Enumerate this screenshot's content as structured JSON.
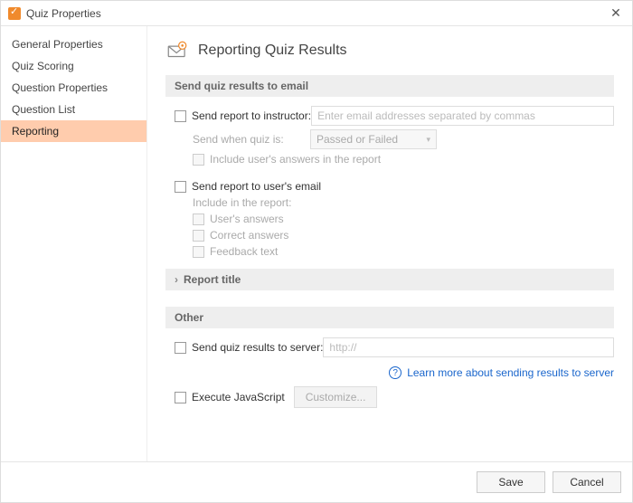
{
  "window": {
    "title": "Quiz Properties",
    "close_label": "✕"
  },
  "sidebar": {
    "items": [
      {
        "label": "General Properties"
      },
      {
        "label": "Quiz Scoring"
      },
      {
        "label": "Question Properties"
      },
      {
        "label": "Question List"
      },
      {
        "label": "Reporting"
      }
    ],
    "selected_index": 4
  },
  "page": {
    "title": "Reporting Quiz Results"
  },
  "sections": {
    "email_header": "Send quiz results to email",
    "other_header": "Other",
    "report_title_header": "Report title"
  },
  "email": {
    "to_instructor": {
      "label": "Send report to instructor:",
      "placeholder": "Enter email addresses separated by commas",
      "value": ""
    },
    "send_when": {
      "label": "Send when quiz is:",
      "selected": "Passed or Failed"
    },
    "include_answers_label": "Include user's answers in the report",
    "to_user": {
      "label": "Send report to user's email",
      "include_header": "Include in the report:",
      "opt_user_answers": "User's answers",
      "opt_correct_answers": "Correct answers",
      "opt_feedback": "Feedback text"
    }
  },
  "other": {
    "send_to_server": {
      "label": "Send quiz results to server:",
      "placeholder": "http://",
      "value": ""
    },
    "learn_more": "Learn more about sending results to server",
    "execute_js_label": "Execute JavaScript",
    "customize_btn": "Customize..."
  },
  "footer": {
    "save": "Save",
    "cancel": "Cancel"
  }
}
